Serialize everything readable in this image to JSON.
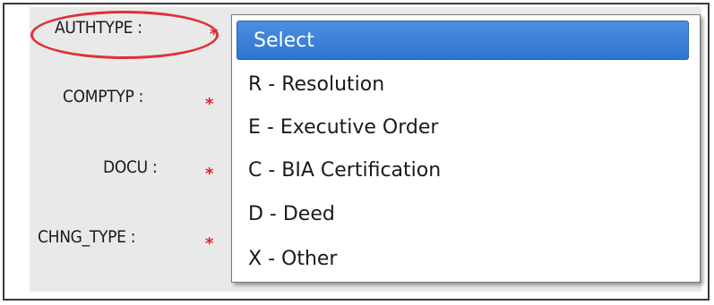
{
  "form": {
    "fields": [
      {
        "label": "AUTHTYPE :",
        "required": "*"
      },
      {
        "label": "COMPTYP :",
        "required": "*"
      },
      {
        "label": "DOCU :",
        "required": "*"
      },
      {
        "label": "CHNG_TYPE :",
        "required": "*"
      }
    ]
  },
  "dropdown": {
    "selected": "Select",
    "options": [
      "Select",
      "R - Resolution",
      "E - Executive Order",
      "C - BIA Certification",
      "D - Deed",
      "X - Other"
    ]
  },
  "colors": {
    "selection": "#2f74d0",
    "required_marker": "#e0242b",
    "highlight_ellipse": "#e03038",
    "panel_background": "#e9e9e9"
  }
}
